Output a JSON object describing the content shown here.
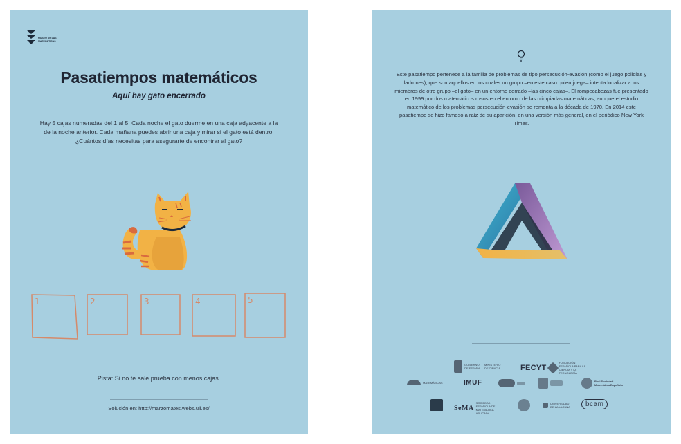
{
  "page1": {
    "logo_text": "MUSEO DE LAS MATEMÁTICAS",
    "title": "Pasatiempos matemáticos",
    "subtitle": "Aquí hay gato encerrado",
    "body": "Hay 5 cajas numeradas del 1 al 5. Cada noche el gato duerme en una caja adyacente a la de la noche anterior. Cada mañana puedes abrir una caja y mirar si el gato está dentro. ¿Cuántos días necesitas para asegurarte de encontrar al gato?",
    "boxes": [
      "1",
      "2",
      "3",
      "4",
      "5"
    ],
    "hint": "Pista: Si no te sale prueba con menos cajas.",
    "solution": "Solución en: http://marzomates.webs.ull.es/"
  },
  "page2": {
    "body": "Este pasatiempo pertenece a la familia de problemas de tipo persecución-evasión (como el juego policías y ladrones), que son aquellos en los cuales un grupo –en este caso quien juega– intenta localizar a los miembros de otro grupo –el gato– en un entorno cerrado –las cinco cajas–. El rompecabezas fue presentado en 1999 por dos matemáticos rusos en el entorno de las olimpiadas matemáticas, aunque el estudio matemático de los problemas persecución-evasión se remonta a la década de 1970. En 2014 este pasatiempo se hizo famoso a raíz de su aparición, en una versión más general, en el periódico New York Times.",
    "sponsors": {
      "gobierno": "GOBIERNO DE ESPAÑA",
      "ministerio": "MINISTERIO DE CIENCIA",
      "fecyt": "FECYT",
      "fecyt_sub": "FUNDACIÓN ESPAÑOLA PARA LA CIENCIA Y LA TECNOLOGÍA",
      "matematicas": "MATEMÁTICAS",
      "imuf": "IMUF",
      "rsme": "Real Sociedad Matemática Española",
      "sema": "SeMA",
      "sema_sub": "SOCIEDAD ESPAÑOLA DE MATEMÁTICA APLICADA",
      "ull": "UNIVERSIDAD DE LA LAGUNA",
      "bcam": "bcam"
    }
  },
  "colors": {
    "page_background": "#a7cfe0",
    "box_stroke": "#d58a6a",
    "cat_orange": "#f2b245"
  },
  "icons": [
    "museum-logo-icon",
    "cat-illustration",
    "lightbulb-icon",
    "penrose-triangle-illustration"
  ]
}
